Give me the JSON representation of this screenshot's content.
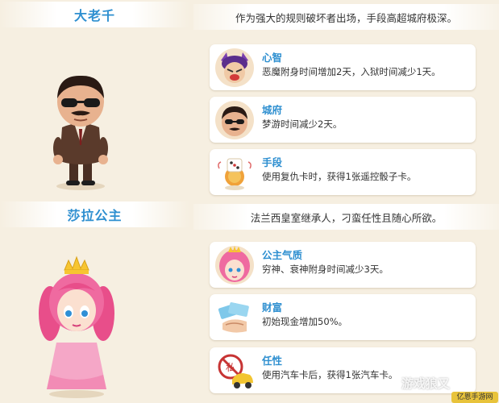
{
  "characters": [
    {
      "name": "大老千",
      "intro": "作为强大的规则破坏者出场，手段高超城府极深。",
      "portrait_icon": "gangster-character-portrait",
      "traits": [
        {
          "title": "心智",
          "desc": "恶魔附身时间增加2天，入狱时间减少1天。",
          "icon": "demon-icon"
        },
        {
          "title": "城府",
          "desc": "梦游时间减少2天。",
          "icon": "gangster-face-icon"
        },
        {
          "title": "手段",
          "desc": "使用复仇卡时，获得1张遥控骰子卡。",
          "icon": "remote-dice-icon"
        }
      ]
    },
    {
      "name": "莎拉公主",
      "intro": "法兰西皇室继承人，刁蛮任性且随心所欲。",
      "portrait_icon": "princess-character-portrait",
      "traits": [
        {
          "title": "公主气质",
          "desc": "穷神、衰神附身时间减少3天。",
          "icon": "princess-face-icon"
        },
        {
          "title": "财富",
          "desc": "初始现金增加50%。",
          "icon": "money-icon"
        },
        {
          "title": "任性",
          "desc": "使用汽车卡后，获得1张汽车卡。",
          "icon": "car-card-icon"
        }
      ]
    }
  ],
  "watermark": {
    "text": "游戏狼又",
    "badge": "亿恩手游网"
  },
  "colors": {
    "accent": "#2e8fd0",
    "background": "#f6efe1",
    "card": "#ffffff"
  }
}
